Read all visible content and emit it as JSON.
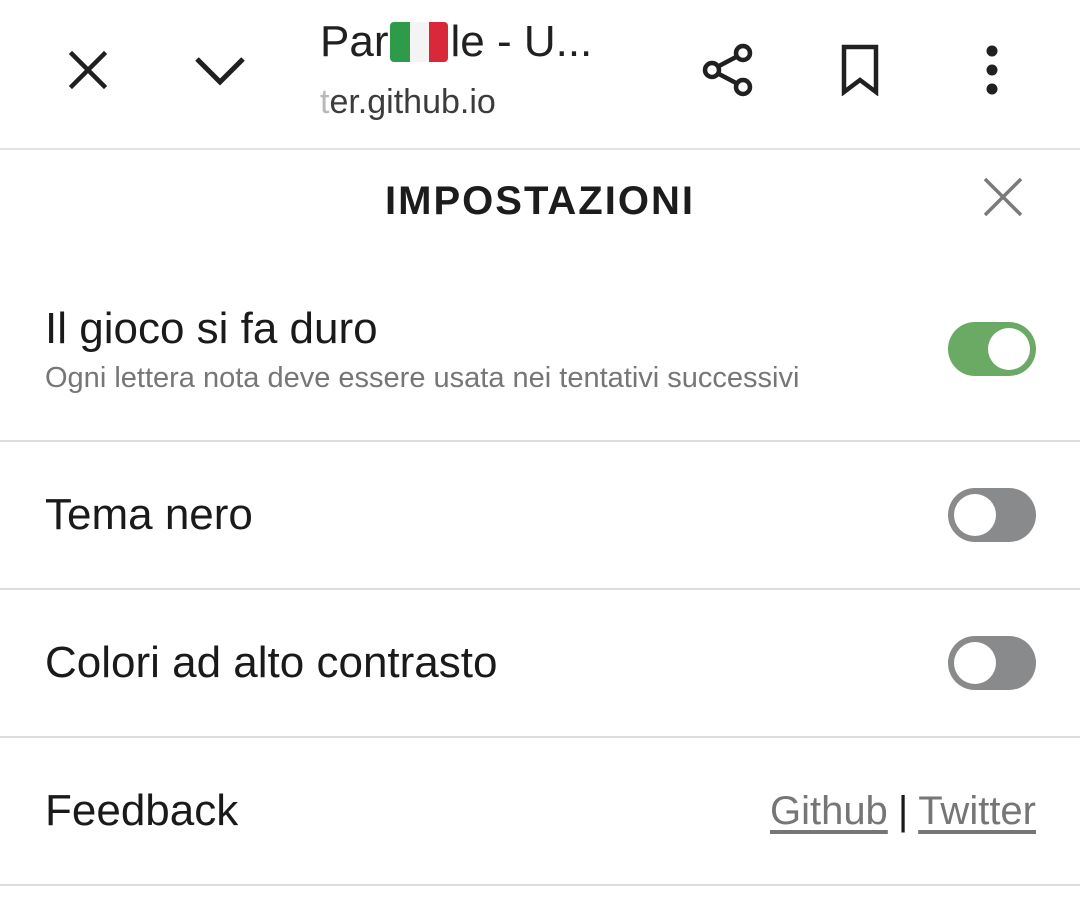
{
  "browser": {
    "title_before_flag": "Par",
    "title_after_flag": "le - U...",
    "flag": "italy-flag",
    "url_faded": "t",
    "url_main": "er.github.io",
    "icons": {
      "close": "close-icon",
      "collapse": "chevron-down-icon",
      "share": "share-icon",
      "bookmark": "bookmark-icon",
      "more": "more-vert-icon"
    }
  },
  "settings": {
    "heading": "IMPOSTAZIONI",
    "close_icon": "close-icon",
    "items": [
      {
        "label": "Il gioco si fa duro",
        "description": "Ogni lettera nota deve essere usata nei tentativi successivi",
        "enabled": true
      },
      {
        "label": "Tema nero",
        "enabled": false
      },
      {
        "label": "Colori ad alto contrasto",
        "enabled": false
      }
    ],
    "feedback": {
      "label": "Feedback",
      "link1": "Github",
      "separator": "|",
      "link2": "Twitter"
    }
  },
  "colors": {
    "toggle_on": "#6aaa64",
    "toggle_off": "#888a8c",
    "muted_text": "#767676"
  }
}
